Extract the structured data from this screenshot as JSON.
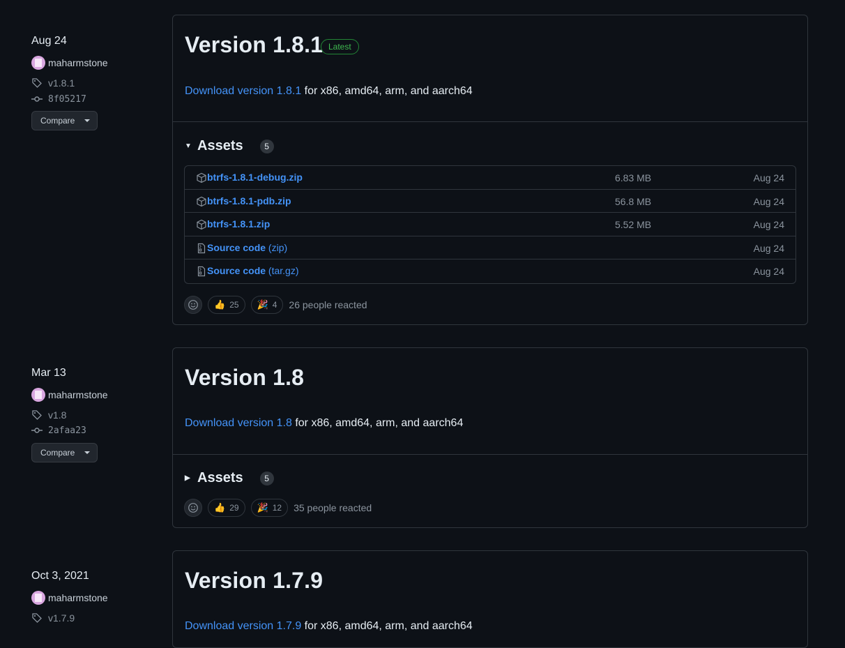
{
  "releases": [
    {
      "date": "Aug 24",
      "author": "maharmstone",
      "tag": "v1.8.1",
      "commit": "8f05217",
      "compare_label": "Compare",
      "title": "Version 1.8.1",
      "latest_badge": "Latest",
      "download_link": "Download version 1.8.1",
      "download_suffix": " for x86, amd64, arm, and aarch64",
      "assets_label": "Assets",
      "assets_count": "5",
      "assets_expanded": true,
      "assets": [
        {
          "name": "btrfs-1.8.1-debug.zip",
          "size": "6.83 MB",
          "date": "Aug 24",
          "icon": "package-icon"
        },
        {
          "name": "btrfs-1.8.1-pdb.zip",
          "size": "56.8 MB",
          "date": "Aug 24",
          "icon": "package-icon"
        },
        {
          "name": "btrfs-1.8.1.zip",
          "size": "5.52 MB",
          "date": "Aug 24",
          "icon": "package-icon"
        },
        {
          "name": "Source code",
          "suffix": "(zip)",
          "size": "",
          "date": "Aug 24",
          "icon": "file-zip-icon"
        },
        {
          "name": "Source code",
          "suffix": "(tar.gz)",
          "size": "",
          "date": "Aug 24",
          "icon": "file-zip-icon"
        }
      ],
      "reactions": {
        "thumbs_up": "25",
        "tada": "4",
        "summary": "26 people reacted"
      }
    },
    {
      "date": "Mar 13",
      "author": "maharmstone",
      "tag": "v1.8",
      "commit": "2afaa23",
      "compare_label": "Compare",
      "title": "Version 1.8",
      "download_link": "Download version 1.8",
      "download_suffix": " for x86, amd64, arm, and aarch64",
      "assets_label": "Assets",
      "assets_count": "5",
      "assets_expanded": false,
      "reactions": {
        "thumbs_up": "29",
        "tada": "12",
        "summary": "35 people reacted"
      }
    },
    {
      "date": "Oct 3, 2021",
      "author": "maharmstone",
      "tag": "v1.7.9",
      "title": "Version 1.7.9",
      "download_link": "Download version 1.7.9",
      "download_suffix": " for x86, amd64, arm, and aarch64"
    }
  ]
}
